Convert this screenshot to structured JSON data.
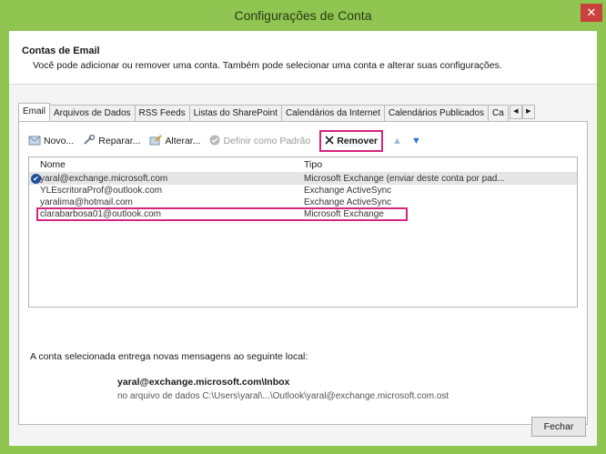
{
  "window": {
    "title": "Configurações de Conta",
    "close_glyph": "✕",
    "title_bar_color": "#8fc550"
  },
  "header": {
    "title": "Contas de Email",
    "description": "Você pode adicionar ou remover uma conta. Também pode selecionar uma conta e alterar suas configurações."
  },
  "tabs": [
    {
      "label": "Email",
      "active": true
    },
    {
      "label": "Arquivos de Dados"
    },
    {
      "label": "RSS Feeds"
    },
    {
      "label": "Listas do SharePoint"
    },
    {
      "label": "Calendários da Internet"
    },
    {
      "label": "Calendários Publicados"
    },
    {
      "label": "Ca"
    }
  ],
  "toolbar": {
    "new_label": "Novo...",
    "new_icon": "new-account-icon",
    "repair_label": "Reparar...",
    "repair_icon": "repair-icon",
    "change_label": "Alterar...",
    "change_icon": "change-icon",
    "default_label": "Definir como Padrão",
    "default_icon": "checkmark-icon",
    "remove_label": "Remover",
    "remove_icon": "x-icon",
    "up_icon": "arrow-up-icon",
    "down_icon": "arrow-down-icon"
  },
  "accounts": {
    "header_name": "Nome",
    "header_type": "Tipo",
    "rows": [
      {
        "name": "yaral@exchange.microsoft.com",
        "type": "Microsoft Exchange (enviar deste conta por pad...",
        "default": true
      },
      {
        "name": "YLEscritoraProf@outlook.com",
        "type": "Exchange ActiveSync"
      },
      {
        "name": "yaralima@hotmail.com",
        "type": "Exchange ActiveSync"
      },
      {
        "name": "clarabarbosa01@outlook.com",
        "type": "Microsoft Exchange"
      }
    ]
  },
  "delivery": {
    "label": "A conta selecionada entrega novas mensagens ao seguinte local:",
    "mailbox": "yaral@exchange.microsoft.com\\Inbox",
    "path": "no arquivo de dados C:\\Users\\yaral\\...\\Outlook\\yaral@exchange.microsoft.com.ost"
  },
  "buttons": {
    "close_label": "Fechar"
  },
  "colors": {
    "highlight": "#d6237d",
    "accent": "#8fc550"
  }
}
